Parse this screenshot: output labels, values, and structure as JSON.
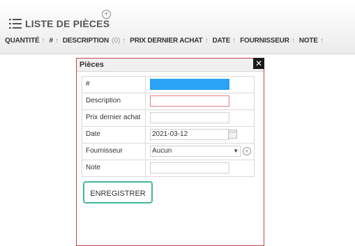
{
  "header": {
    "title": "LISTE DE PIÈCES",
    "add_icon": "plus-circle-icon",
    "list_icon": "list-icon"
  },
  "columns": [
    {
      "label": "QUANTITÉ",
      "sort": "↑"
    },
    {
      "label": "#",
      "sort": "↑"
    },
    {
      "label": "DESCRIPTION",
      "count": "(0)",
      "sort": "↑"
    },
    {
      "label": "PRIX DERNIER ACHAT",
      "sort": "↑"
    },
    {
      "label": "DATE",
      "sort": "↑"
    },
    {
      "label": "FOURNISSEUR",
      "sort": "↑"
    },
    {
      "label": "NOTE",
      "sort": "↑"
    }
  ],
  "dialog": {
    "title": "Pièces",
    "close_label": "✕",
    "fields": {
      "number": {
        "label": "#",
        "value": ""
      },
      "description": {
        "label": "Description",
        "value": ""
      },
      "price": {
        "label": "Prix dernier achat",
        "value": ""
      },
      "date": {
        "label": "Date",
        "value": "2021-03-12"
      },
      "supplier": {
        "label": "Fournisseur",
        "value": "Aucun"
      },
      "note": {
        "label": "Note",
        "value": ""
      }
    },
    "save_label": "ENREGISTRER"
  },
  "colors": {
    "accent_blue": "#2aa4f4",
    "error_red": "#e57e87",
    "save_border": "#43b79a",
    "dialog_border": "#c7444a"
  }
}
